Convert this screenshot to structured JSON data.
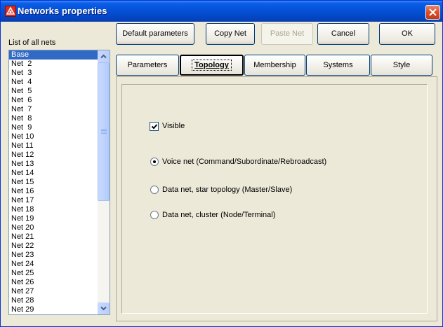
{
  "window": {
    "title": "Networks properties",
    "icon": "network-app-icon",
    "close_icon": "close-icon"
  },
  "nets": {
    "label": "List of all nets",
    "selected_index": 0,
    "items": [
      "Base",
      "Net  2",
      "Net  3",
      "Net  4",
      "Net  5",
      "Net  6",
      "Net  7",
      "Net  8",
      "Net  9",
      "Net 10",
      "Net 11",
      "Net 12",
      "Net 13",
      "Net 14",
      "Net 15",
      "Net 16",
      "Net 17",
      "Net 18",
      "Net 19",
      "Net 20",
      "Net 21",
      "Net 22",
      "Net 23",
      "Net 24",
      "Net 25",
      "Net 26",
      "Net 27",
      "Net 28",
      "Net 29"
    ]
  },
  "buttons": {
    "default_parameters": "Default parameters",
    "copy_net": "Copy Net",
    "paste_net": "Paste Net",
    "cancel": "Cancel",
    "ok": "OK"
  },
  "tabs": {
    "active": "Topology",
    "items": [
      "Parameters",
      "Topology",
      "Membership",
      "Systems",
      "Style"
    ]
  },
  "topology": {
    "visible": {
      "label": "Visible",
      "checked": true
    },
    "selected_option": 0,
    "options": [
      "Voice net (Command/Subordinate/Rebroadcast)",
      "Data net, star topology (Master/Slave)",
      "Data net, cluster (Node/Terminal)"
    ]
  },
  "colors": {
    "titlebar": "#0551d6",
    "selection": "#316ac5",
    "dialog_bg": "#ece9d8"
  }
}
